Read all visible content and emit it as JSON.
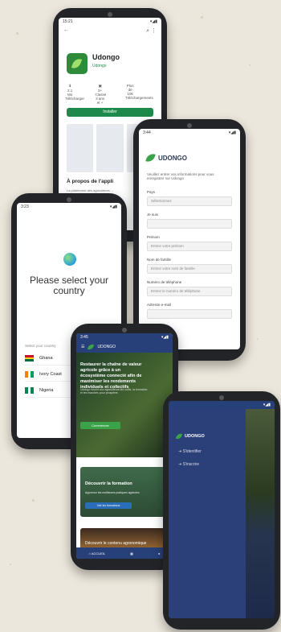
{
  "playstore": {
    "status_time": "15:21",
    "app_name": "Udongo",
    "developer": "Udongo",
    "stats": [
      {
        "value": "2.1 Mo",
        "label": "Télécharger"
      },
      {
        "value": "3+",
        "label": "Classé 3 ans et +"
      },
      {
        "value": "Plus de 10k",
        "label": "Téléchargements"
      }
    ],
    "install_label": "Installer",
    "about_title": "À propos de l'appli",
    "about_desc": "La plateforme des agriculteurs ..."
  },
  "form": {
    "status_time": "3:44",
    "brand": "UDONGO",
    "intro": "Veuillez entrer vos informations pour vous enregistrer sur Udongo",
    "fields": [
      {
        "label": "Pays",
        "value": "Sélectionnez"
      },
      {
        "label": "Je suis",
        "value": ""
      },
      {
        "label": "Prénom",
        "value": "Entrez votre prénom"
      },
      {
        "label": "Nom de famille",
        "value": "Entrez votre nom de famille"
      },
      {
        "label": "Numéro de téléphone",
        "value": "Entrez le numéro de téléphone"
      },
      {
        "label": "Adresse e-mail",
        "value": ""
      }
    ]
  },
  "country": {
    "status_time": "3:23",
    "title": "Please select your country",
    "selector_label": "Select your country",
    "countries": [
      {
        "name": "Ghana",
        "flag": [
          "#ce1126",
          "#fcd116",
          "#006b3f"
        ]
      },
      {
        "name": "Ivory Coast",
        "flag": [
          "#f77f00",
          "#ffffff",
          "#009e60"
        ]
      },
      {
        "name": "Nigeria",
        "flag": [
          "#008751",
          "#ffffff",
          "#008751"
        ]
      }
    ]
  },
  "home": {
    "status_time": "3:45",
    "brand": "UDONGO",
    "hero_title": "Restaurer la chaîne de valeur agricole grâce à un écosystème connecté afin de maximiser les rendements individuels et collectifs",
    "hero_sub": "Udongo fournit aux agriculteurs les outils, la formation et les marchés pour prospérer.",
    "hero_button": "Commencer",
    "card1_title": "Découvrir la formation",
    "card1_text": "Apprenez les meilleures pratiques agricoles",
    "card1_button": "Voir les formations",
    "card2_title": "Découvrir le contenu agronomique",
    "nav": [
      "ACCUEIL",
      "",
      ""
    ]
  },
  "drawer": {
    "brand": "UDONGO",
    "items": [
      "S'identifier",
      "S'inscrire"
    ]
  }
}
